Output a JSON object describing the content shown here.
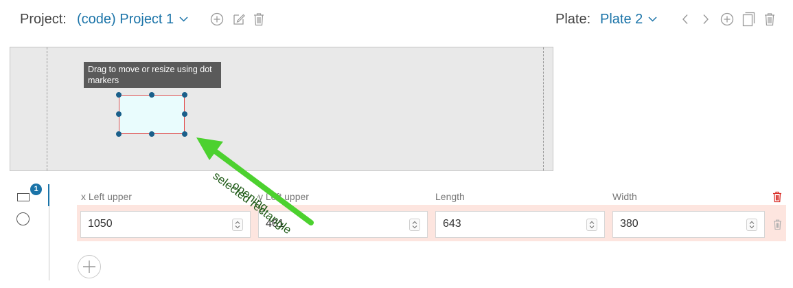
{
  "topbar": {
    "project_label": "Project:",
    "project_value": "(code) Project 1",
    "plate_label": "Plate:",
    "plate_value": "Plate 2"
  },
  "canvas": {
    "tooltip": "Drag to move or resize using dot markers"
  },
  "sidebar": {
    "badge_count": "1"
  },
  "columns": {
    "x": "x Left upper",
    "y": "y Left upper",
    "length": "Length",
    "width": "Width"
  },
  "row": {
    "x": "1050",
    "y": "461",
    "length": "643",
    "width": "380"
  },
  "annotation": {
    "line1": "selected rectangle",
    "line2": "opening"
  },
  "colors": {
    "accent": "#1a73a8",
    "delete_red": "#d9302a",
    "row_highlight": "#fde5df",
    "arrow_green": "#4cd12f"
  }
}
